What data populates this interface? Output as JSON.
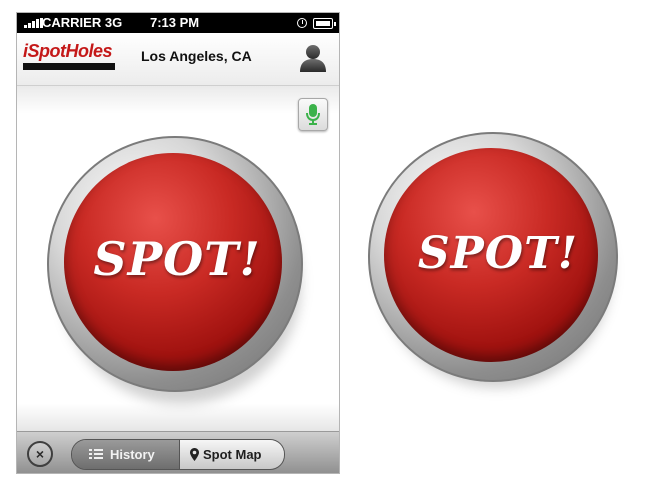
{
  "status_bar": {
    "carrier": "CARRIER",
    "network": "3G",
    "time": "7:13 PM"
  },
  "header": {
    "logo_text": "iSpotHoles",
    "location": "Los Angeles, CA"
  },
  "main": {
    "spot_button_label": "SPOT!"
  },
  "toolbar": {
    "close_symbol": "×",
    "segments": [
      {
        "label": "History",
        "icon": "list-icon",
        "selected": false
      },
      {
        "label": "Spot Map",
        "icon": "map-pin-icon",
        "selected": true
      }
    ]
  },
  "standalone": {
    "spot_button_label": "SPOT!"
  },
  "colors": {
    "brand_red": "#c41818",
    "mic_green": "#3bb24a"
  }
}
